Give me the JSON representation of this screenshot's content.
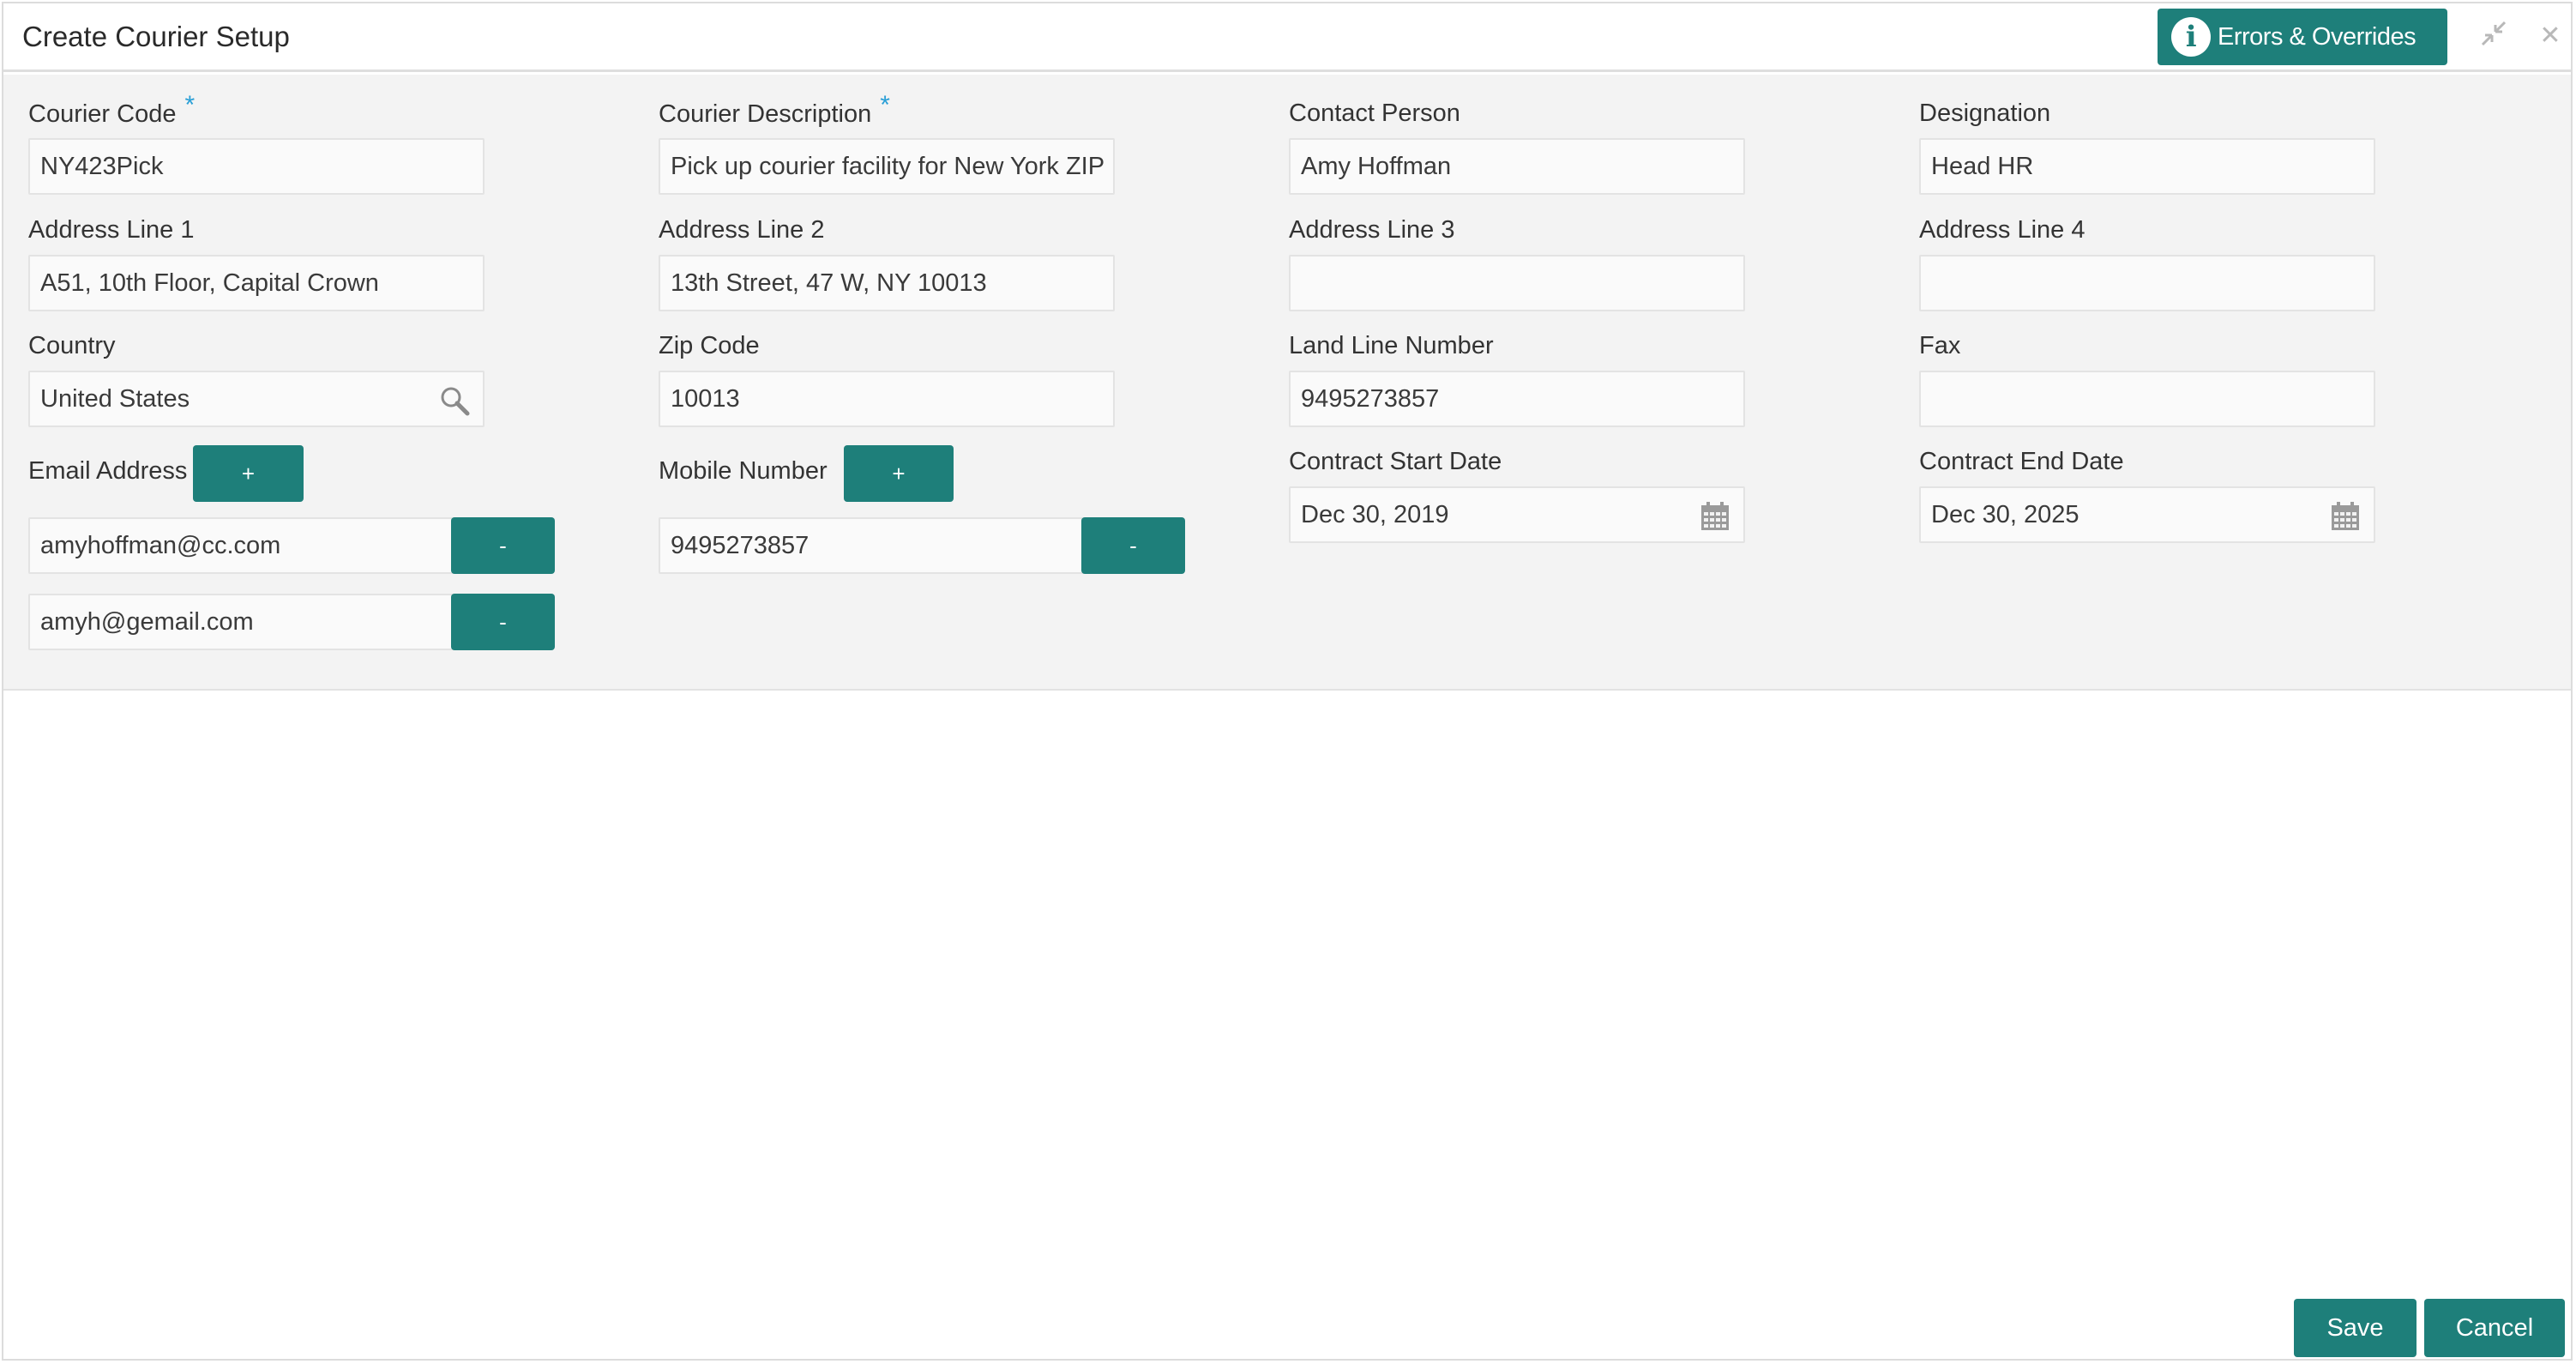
{
  "window": {
    "title": "Create Courier Setup",
    "errors_label": "Errors & Overrides",
    "info_glyph": "i",
    "minimize_icon": "collapse-arrows-icon",
    "close_glyph": "✕"
  },
  "form": {
    "courier_code": {
      "label": "Courier Code",
      "required_mark": "*",
      "value": "NY423Pick"
    },
    "courier_description": {
      "label": "Courier Description",
      "required_mark": "*",
      "value": "Pick up courier facility for New York ZIP"
    },
    "contact_person": {
      "label": "Contact Person",
      "value": "Amy Hoffman"
    },
    "designation": {
      "label": "Designation",
      "value": "Head HR"
    },
    "address_line_1": {
      "label": "Address Line 1",
      "value": "A51, 10th Floor, Capital Crown"
    },
    "address_line_2": {
      "label": "Address Line 2",
      "value": "13th Street, 47 W, NY 10013"
    },
    "address_line_3": {
      "label": "Address Line 3",
      "value": ""
    },
    "address_line_4": {
      "label": "Address Line 4",
      "value": ""
    },
    "country": {
      "label": "Country",
      "value": "United States"
    },
    "zip_code": {
      "label": "Zip Code",
      "value": "10013"
    },
    "land_line_number": {
      "label": "Land Line Number",
      "value": "9495273857"
    },
    "fax": {
      "label": "Fax",
      "value": ""
    },
    "email_address": {
      "label": "Email Address",
      "add_label": "+",
      "remove_label": "-",
      "values": [
        "amyhoffman@cc.com",
        "amyh@gemail.com"
      ]
    },
    "mobile_number": {
      "label": "Mobile Number",
      "add_label": "+",
      "remove_label": "-",
      "values": [
        "9495273857"
      ]
    },
    "contract_start_date": {
      "label": "Contract Start Date",
      "value": "Dec 30, 2019"
    },
    "contract_end_date": {
      "label": "Contract End Date",
      "value": "Dec 30, 2025"
    }
  },
  "footer": {
    "save_label": "Save",
    "cancel_label": "Cancel"
  },
  "colors": {
    "accent": "#1e7f7a",
    "required": "#2a9fd6",
    "panel_bg": "#f3f3f3"
  }
}
